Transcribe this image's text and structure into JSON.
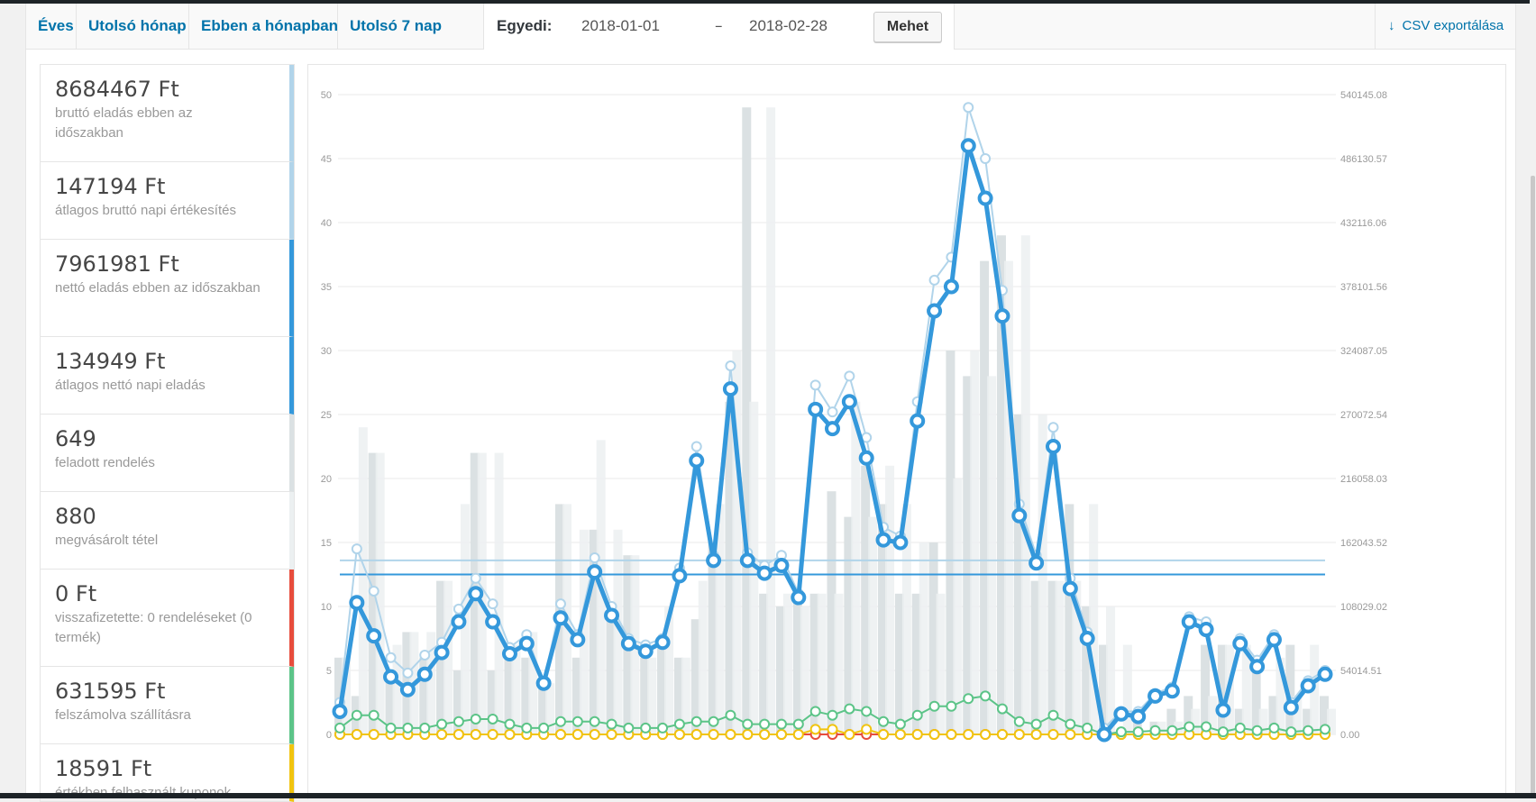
{
  "tabs": [
    {
      "label": "Éves"
    },
    {
      "label": "Utolsó hónap"
    },
    {
      "label": "Ebben a hónapban"
    },
    {
      "label": "Utolsó 7 nap"
    }
  ],
  "custom": {
    "label": "Egyedi:",
    "start_date": "2018-01-01",
    "separator": "–",
    "end_date": "2018-02-28",
    "go_label": "Mehet"
  },
  "export": {
    "label": "CSV exportálása",
    "icon": "download-arrow-icon"
  },
  "legend": [
    {
      "amount": "8684467 Ft",
      "desc": "bruttó eladás ebben az időszakban",
      "color": "#b1d4ea"
    },
    {
      "amount": "147194 Ft",
      "desc": "átlagos bruttó napi értékesítés",
      "color": "#b1d4ea"
    },
    {
      "amount": "7961981 Ft",
      "desc": "nettó eladás ebben az időszakban",
      "color": "#3498db"
    },
    {
      "amount": "134949 Ft",
      "desc": "átlagos nettó napi eladás",
      "color": "#3498db"
    },
    {
      "amount": "649",
      "desc": "feladott rendelés",
      "color": "#dbe1e3"
    },
    {
      "amount": "880",
      "desc": "megvásárolt tétel",
      "color": "#ecf0f1"
    },
    {
      "amount": "0 Ft",
      "desc": "visszafizetette: 0 rendeléseket (0 termék)",
      "color": "#e74c3c"
    },
    {
      "amount": "631595 Ft",
      "desc": "felszámolva szállításra",
      "color": "#5cc488"
    },
    {
      "amount": "18591 Ft",
      "desc": "értékben felhasznált kuponok",
      "color": "#f1c40f"
    }
  ],
  "chart_data": {
    "type": "bar+line",
    "left_axis": {
      "min": 0,
      "max": 50,
      "ticks": [
        "0",
        "5",
        "10",
        "15",
        "20",
        "25",
        "30",
        "35",
        "40",
        "45",
        "50"
      ]
    },
    "right_axis": {
      "min": 0,
      "max": 540145.08,
      "ticks": [
        "0.00",
        "54014.51",
        "108029.02",
        "162043.52",
        "216058.03",
        "270072.54",
        "324087.05",
        "378101.56",
        "432116.06",
        "486130.57",
        "540145.08"
      ]
    },
    "days": 59,
    "bars_orders": [
      6,
      3,
      22,
      5,
      8,
      6,
      12,
      5,
      22,
      5,
      7,
      6,
      4,
      18,
      6,
      16,
      9,
      14,
      6,
      7,
      6,
      9,
      15,
      26,
      49,
      11,
      10,
      11,
      11,
      19,
      17,
      21,
      18,
      11,
      11,
      15,
      30,
      28,
      37,
      39,
      25,
      12,
      12,
      18,
      10,
      7,
      0,
      1,
      1,
      2,
      3,
      7,
      7,
      2,
      6,
      3,
      7,
      2,
      3
    ],
    "bars_items": [
      6,
      24,
      22,
      7,
      8,
      8,
      12,
      18,
      22,
      22,
      7,
      8,
      4,
      18,
      16,
      23,
      16,
      14,
      6,
      10,
      6,
      12,
      18,
      30,
      26,
      49,
      11,
      10,
      11,
      11,
      26,
      17,
      21,
      18,
      15,
      11,
      20,
      30,
      28,
      37,
      39,
      25,
      12,
      12,
      18,
      10,
      7,
      0,
      1,
      1,
      2,
      3,
      7,
      7,
      2,
      6,
      3,
      7,
      2
    ],
    "series": [
      {
        "name": "bruttó eladás",
        "color": "#b1d4ea",
        "values": [
          2.5,
          14.5,
          11.2,
          6,
          4.8,
          6.2,
          7.2,
          9.8,
          12.2,
          10.2,
          6.8,
          7.8,
          4,
          10.2,
          7.8,
          13.8,
          10,
          7.5,
          7,
          7.5,
          13,
          22.5,
          14,
          28.8,
          14.2,
          13.2,
          14,
          11,
          27.3,
          25.2,
          28,
          23.2,
          16.2,
          15.5,
          26,
          35.5,
          37.3,
          49,
          45,
          34.7,
          18,
          14,
          24,
          12.2,
          8,
          0.5,
          1.8,
          1.8,
          3.2,
          3.7,
          9.2,
          8.8,
          2,
          7.5,
          5.8,
          7.8,
          2.5,
          4.2,
          5
        ]
      },
      {
        "name": "nettó eladás",
        "color": "#3498db",
        "values": [
          1.8,
          10.3,
          7.7,
          4.5,
          3.5,
          4.7,
          6.4,
          8.8,
          11,
          8.8,
          6.3,
          7.1,
          4,
          9.1,
          7.4,
          12.7,
          9.3,
          7.1,
          6.5,
          7.2,
          12.4,
          21.4,
          13.6,
          27,
          13.6,
          12.6,
          13.2,
          10.7,
          25.4,
          23.9,
          26,
          21.6,
          15.2,
          15,
          24.5,
          33.1,
          35,
          46,
          41.9,
          32.7,
          17.1,
          13.4,
          22.5,
          11.4,
          7.5,
          0,
          1.6,
          1.4,
          3,
          3.4,
          8.8,
          8.2,
          1.9,
          7.1,
          5.3,
          7.4,
          2.1,
          3.8,
          4.7
        ]
      },
      {
        "name": "szállítás",
        "color": "#5cc488",
        "values": [
          0.5,
          1.5,
          1.5,
          0.5,
          0.5,
          0.5,
          0.8,
          1,
          1.2,
          1.2,
          0.8,
          0.5,
          0.5,
          1,
          1,
          1,
          0.8,
          0.5,
          0.5,
          0.5,
          0.8,
          1,
          1,
          1.5,
          0.8,
          0.8,
          0.8,
          0.8,
          1.8,
          1.5,
          2,
          1.8,
          1,
          0.8,
          1.5,
          2.2,
          2.2,
          2.8,
          3,
          2,
          1,
          0.8,
          1.5,
          0.8,
          0.5,
          0,
          0.2,
          0.2,
          0.3,
          0.3,
          0.6,
          0.6,
          0.2,
          0.5,
          0.3,
          0.5,
          0.2,
          0.3,
          0.4
        ]
      },
      {
        "name": "kuponok",
        "color": "#f1c40f",
        "values": [
          0,
          0,
          0,
          0,
          0,
          0,
          0,
          0,
          0,
          0,
          0,
          0,
          0,
          0,
          0,
          0,
          0,
          0,
          0,
          0,
          0,
          0,
          0,
          0,
          0,
          0,
          0,
          0,
          0.4,
          0.4,
          0,
          0.4,
          0,
          0,
          0,
          0,
          0,
          0,
          0,
          0,
          0,
          0,
          0,
          0,
          0,
          0,
          0,
          0,
          0,
          0,
          0,
          0,
          0,
          0,
          0,
          0,
          0,
          0,
          0
        ]
      },
      {
        "name": "visszafizetés",
        "color": "#e74c3c",
        "values": [
          0,
          0,
          0,
          0,
          0,
          0,
          0,
          0,
          0,
          0,
          0,
          0,
          0,
          0,
          0,
          0,
          0,
          0,
          0,
          0,
          0,
          0,
          0,
          0,
          0,
          0,
          0,
          0,
          0,
          0,
          0,
          0,
          0,
          0,
          0,
          0,
          0,
          0,
          0,
          0,
          0,
          0,
          0,
          0,
          0,
          0,
          0,
          0,
          0,
          0,
          0,
          0,
          0,
          0,
          0,
          0,
          0,
          0,
          0
        ]
      }
    ],
    "avg_gross": 13.6,
    "avg_net": 12.5
  }
}
